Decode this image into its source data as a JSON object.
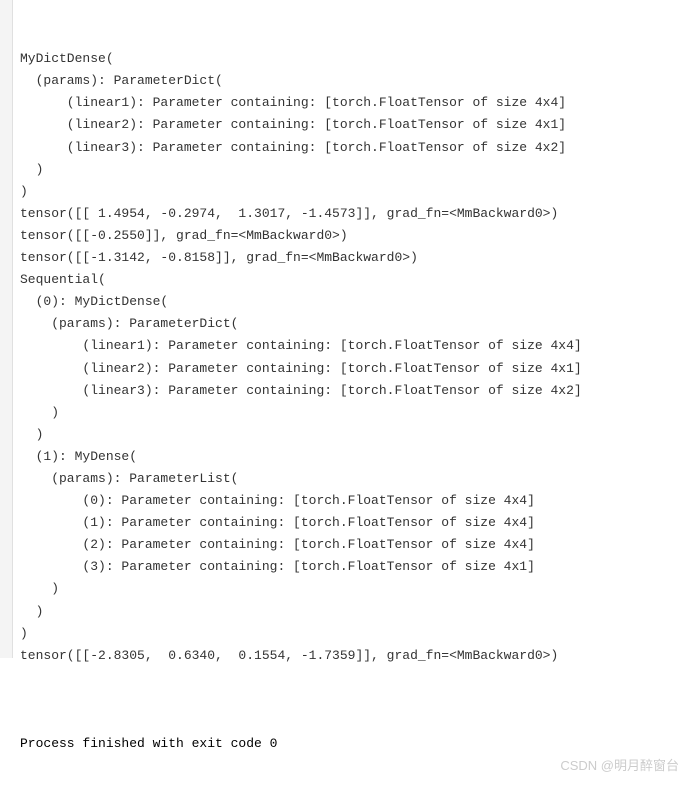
{
  "output": {
    "lines": [
      "MyDictDense(",
      "  (params): ParameterDict(",
      "      (linear1): Parameter containing: [torch.FloatTensor of size 4x4]",
      "      (linear2): Parameter containing: [torch.FloatTensor of size 4x1]",
      "      (linear3): Parameter containing: [torch.FloatTensor of size 4x2]",
      "  )",
      ")",
      "tensor([[ 1.4954, -0.2974,  1.3017, -1.4573]], grad_fn=<MmBackward0>)",
      "tensor([[-0.2550]], grad_fn=<MmBackward0>)",
      "tensor([[-1.3142, -0.8158]], grad_fn=<MmBackward0>)",
      "Sequential(",
      "  (0): MyDictDense(",
      "    (params): ParameterDict(",
      "        (linear1): Parameter containing: [torch.FloatTensor of size 4x4]",
      "        (linear2): Parameter containing: [torch.FloatTensor of size 4x1]",
      "        (linear3): Parameter containing: [torch.FloatTensor of size 4x2]",
      "    )",
      "  )",
      "  (1): MyDense(",
      "    (params): ParameterList(",
      "        (0): Parameter containing: [torch.FloatTensor of size 4x4]",
      "        (1): Parameter containing: [torch.FloatTensor of size 4x4]",
      "        (2): Parameter containing: [torch.FloatTensor of size 4x4]",
      "        (3): Parameter containing: [torch.FloatTensor of size 4x1]",
      "    )",
      "  )",
      ")",
      "tensor([[-2.8305,  0.6340,  0.1554, -1.7359]], grad_fn=<MmBackward0>)",
      ""
    ],
    "exit_line": "Process finished with exit code 0"
  },
  "watermark": "CSDN @明月醉窗台"
}
